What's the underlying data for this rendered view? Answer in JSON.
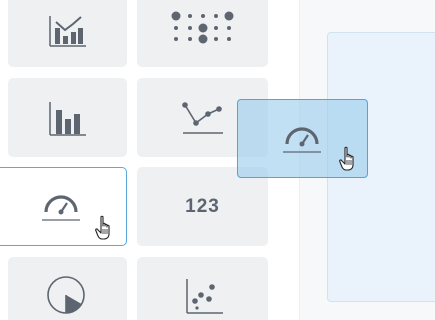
{
  "palette": {
    "tiles": [
      {
        "name": "combo-chart-tile",
        "icon": "combo-chart-icon"
      },
      {
        "name": "dot-matrix-tile",
        "icon": "dot-matrix-icon"
      },
      {
        "name": "bar-chart-tile",
        "icon": "bar-chart-icon"
      },
      {
        "name": "line-chart-tile",
        "icon": "line-chart-icon"
      },
      {
        "name": "gauge-tile",
        "icon": "gauge-icon",
        "selected": true
      },
      {
        "name": "number-tile",
        "label": "123"
      },
      {
        "name": "pie-chart-tile",
        "icon": "pie-chart-icon"
      },
      {
        "name": "scatter-chart-tile",
        "icon": "scatter-chart-icon"
      }
    ]
  },
  "drag_ghost": {
    "icon": "gauge-icon",
    "cursor": "hand-pointer-icon"
  },
  "colors": {
    "tile_bg": "#eef0f2",
    "icon": "#5d6670",
    "accent_border": "#52a5dc",
    "ghost_fill": "#9dcdee",
    "dropzone_fill": "#eaf3fb"
  }
}
